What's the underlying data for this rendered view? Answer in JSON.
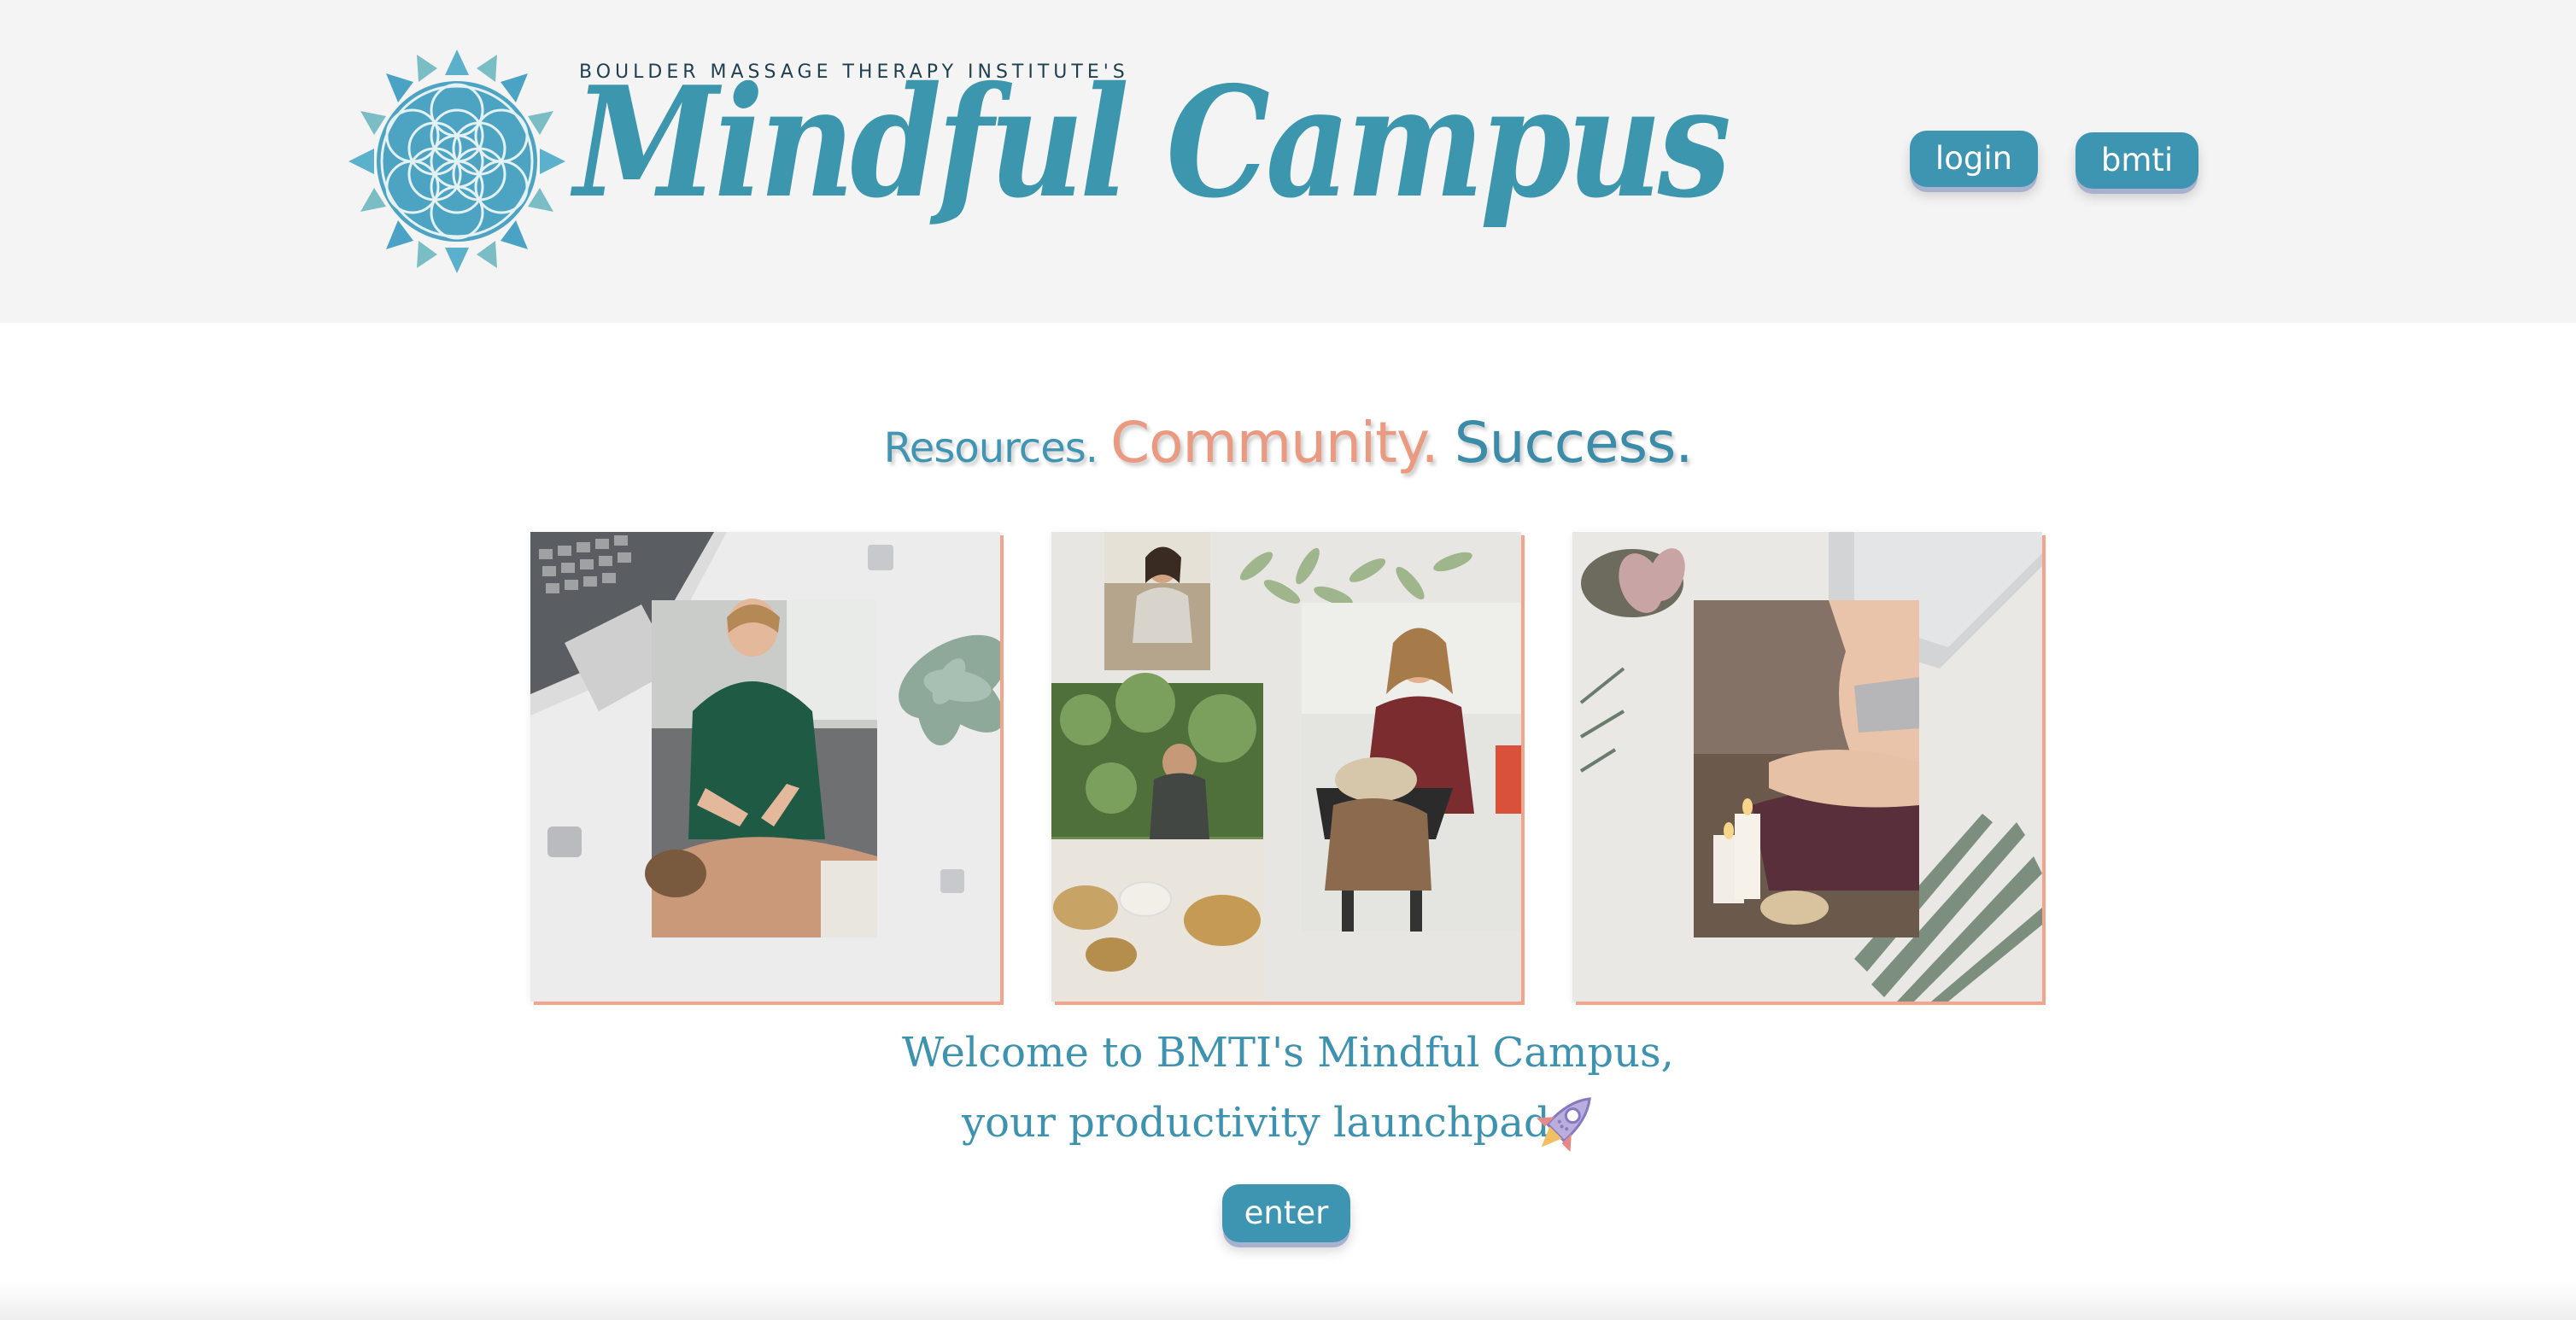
{
  "header": {
    "logo_pre": "BOULDER MASSAGE THERAPY INSTITUTE'S",
    "logo_word": "Mindful Campus",
    "logo_icon": "flower-of-life-lotus-icon",
    "buttons": {
      "login": "login",
      "bmti": "bmti"
    }
  },
  "tagline": {
    "part1": "Resources.",
    "part2": "Community.",
    "part3": "Success."
  },
  "cards": [
    {
      "name": "massage-photo-card",
      "subject": "massage therapist with laptop, succulent and clips"
    },
    {
      "name": "collage-photo-card",
      "subject": "sound bowls, chair massage, student"
    },
    {
      "name": "yoga-photo-card",
      "subject": "meditation pose with candles, laptop, palm leaf"
    }
  ],
  "welcome": {
    "line1": "Welcome to BMTI's Mindful Campus,",
    "line2": "your productivity launchpad."
  },
  "enter_label": "enter",
  "colors": {
    "brand_teal": "#3e95b1",
    "accent_coral": "#ea9a80",
    "header_bg": "#f4f4f4",
    "button_shadow": "#a8b2cf"
  }
}
